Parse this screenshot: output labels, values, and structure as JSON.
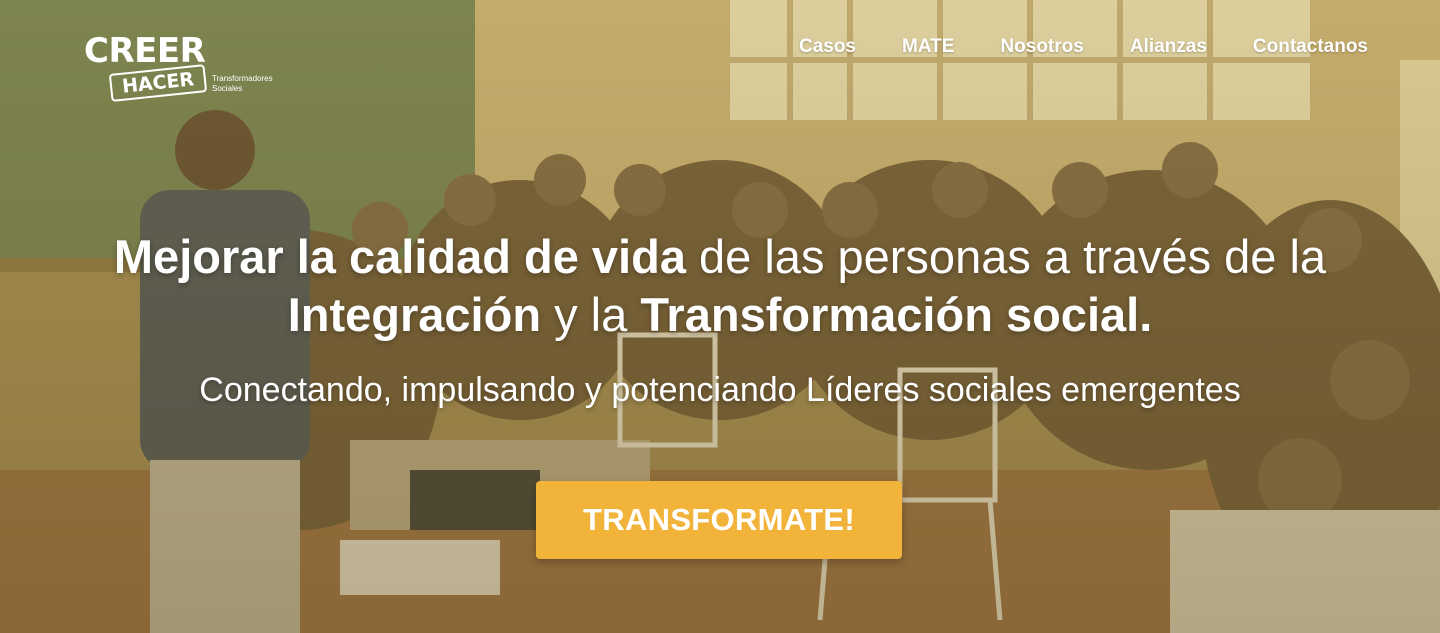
{
  "brand": {
    "logo_line1": "CREER",
    "logo_line2": "HACER",
    "logo_tagline": "Transformadores Sociales"
  },
  "nav": {
    "items": [
      {
        "label": "Casos"
      },
      {
        "label": "MATE"
      },
      {
        "label": "Nosotros"
      },
      {
        "label": "Alianzas"
      },
      {
        "label": "Contactanos"
      }
    ]
  },
  "hero": {
    "headline_part1_bold": "Mejorar la calidad de vida",
    "headline_part2": " de las personas a través de la ",
    "headline_part3_bold": "Integración",
    "headline_part4": " y la ",
    "headline_part5_bold": "Transformación social.",
    "subtitle": "Conectando, impulsando y potenciando Líderes sociales emergentes",
    "cta_label": "TRANSFORMATE!",
    "background_image": "photo of a classroom workshop with many seated participants listening to a speaker at a chalkboard"
  },
  "colors": {
    "cta": "#f2b33a",
    "overlay": "#b4963c",
    "text": "#ffffff"
  }
}
